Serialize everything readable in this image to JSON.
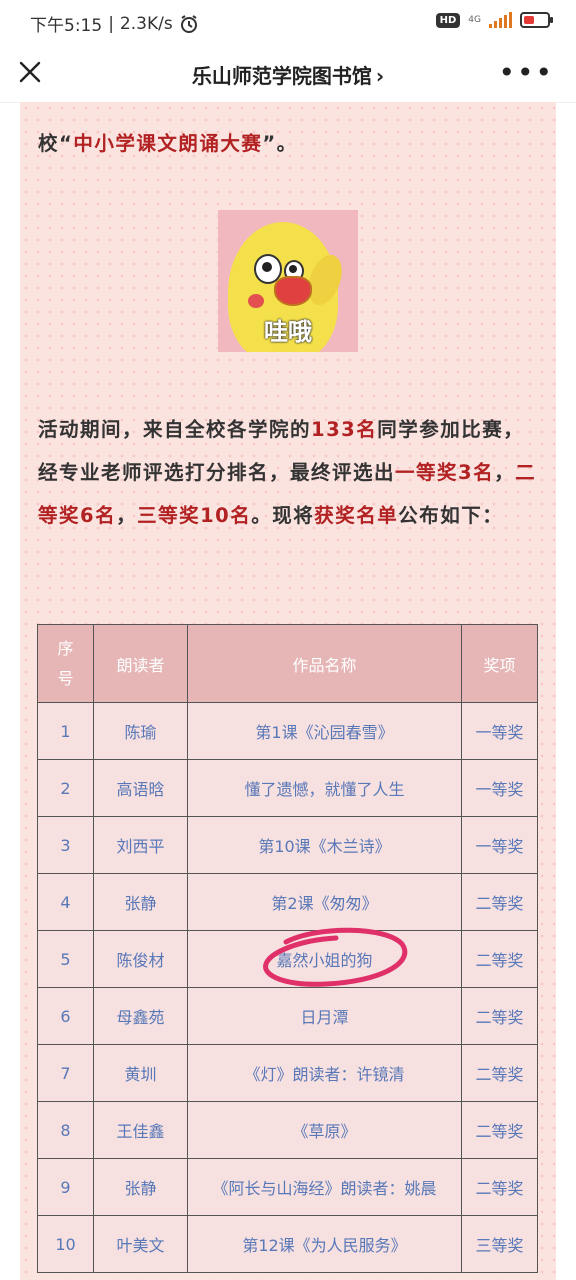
{
  "status_bar": {
    "time": "下午5:15",
    "net_speed": "2.3K/s",
    "network": "4G"
  },
  "nav": {
    "title": "乐山师范学院图书馆",
    "chevron": "›",
    "close_icon": "close-icon",
    "more_icon": "more-icon"
  },
  "article": {
    "partial_line": "校\"中小学课文朗诵大赛\"。",
    "partial_line_prefix": "校“",
    "partial_line_highlight": "中小学课文朗诵大赛",
    "partial_line_suffix": "”。",
    "sticker_caption": "哇哦",
    "para2": {
      "t1": "活动期间，来自全校各学院的",
      "h1": "133名",
      "t2": "同学参加比赛，经专业老师评选打分排名，最终评选出",
      "h2": "一等奖3名",
      "t3": "，",
      "h3": "二等奖6名",
      "t4": "，",
      "h4": "三等奖10名",
      "t5": "。现将",
      "h5": "获奖名单",
      "t6": "公布如下："
    }
  },
  "table": {
    "headers": {
      "seq_line1": "序",
      "seq_line2": "号",
      "reader": "朗读者",
      "work": "作品名称",
      "award": "奖项"
    },
    "rows": [
      {
        "no": "1",
        "reader": "陈瑜",
        "work": "第1课《沁园春雪》",
        "award": "一等奖"
      },
      {
        "no": "2",
        "reader": "高语晗",
        "work": "懂了遗憾，就懂了人生",
        "award": "一等奖"
      },
      {
        "no": "3",
        "reader": "刘西平",
        "work": "第10课《木兰诗》",
        "award": "一等奖"
      },
      {
        "no": "4",
        "reader": "张静",
        "work": "第2课《匆匆》",
        "award": "二等奖"
      },
      {
        "no": "5",
        "reader": "陈俊材",
        "work": "嘉然小姐的狗",
        "award": "二等奖"
      },
      {
        "no": "6",
        "reader": "母鑫苑",
        "work": "日月潭",
        "award": "二等奖"
      },
      {
        "no": "7",
        "reader": "黄圳",
        "work": "《灯》朗读者：许镜清",
        "award": "二等奖"
      },
      {
        "no": "8",
        "reader": "王佳鑫",
        "work": "《草原》",
        "award": "二等奖"
      },
      {
        "no": "9",
        "reader": "张静",
        "work": "《阿长与山海经》朗读者：姚晨",
        "award": "二等奖"
      },
      {
        "no": "10",
        "reader": "叶美文",
        "work": "第12课《为人民服务》",
        "award": "三等奖"
      }
    ]
  },
  "colors": {
    "highlight": "#b22222",
    "table_header": "#e6b6b7",
    "table_cell_text": "#5878b8",
    "annotation_circle": "#e0306a"
  }
}
